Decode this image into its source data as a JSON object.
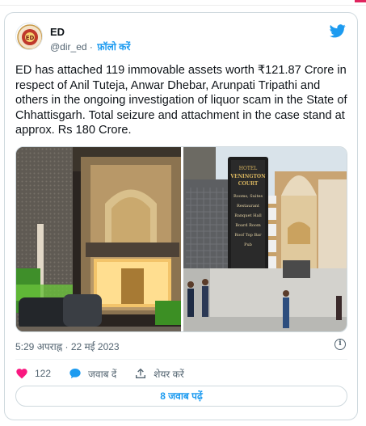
{
  "author": {
    "name": "ED",
    "handle": "@dir_ed",
    "separator": "·",
    "follow_label": "फ़ॉलो करें"
  },
  "tweet": {
    "text": "ED has attached 119 immovable assets worth ₹121.87 Crore in respect of Anil Tuteja, Anwar Dhebar, Arunpati Tripathi and others in the ongoing investigation of liquor scam in the State of Chhattisgarh.  Total seizure and attachment in the case stand at approx. Rs 180 Crore.",
    "timestamp": "5:29 अपराह्न · 22 मई 2023"
  },
  "media": {
    "left_image": "building-night-facade",
    "right_image": "venington-court-hotel",
    "sign_lines": [
      "HOTEL",
      "VENINGTON",
      "COURT",
      "Rooms, Suites",
      "Restaurant",
      "Banquet Hall",
      "Board Room",
      "Roof Top Bar",
      "Pub"
    ]
  },
  "actions": {
    "like_count": "122",
    "reply_label": "जवाब दें",
    "share_label": "शेयर करें"
  },
  "replies_button_label": "8 जवाब पढ़ें",
  "colors": {
    "accent": "#1d9bf0",
    "like": "#f91880",
    "text": "#0f1419",
    "muted": "#536471"
  }
}
